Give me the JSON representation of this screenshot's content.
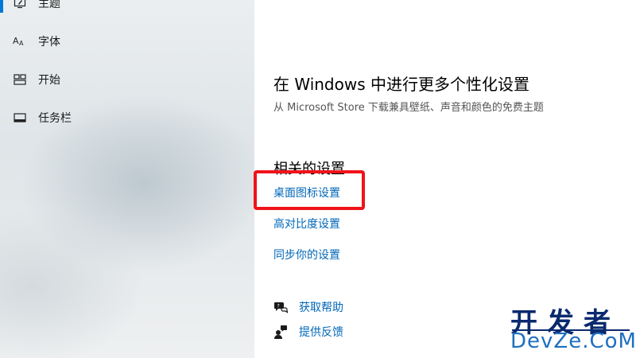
{
  "sidebar": {
    "items": [
      {
        "label": "主题",
        "icon": "theme-icon",
        "active": true
      },
      {
        "label": "字体",
        "icon": "font-icon"
      },
      {
        "label": "开始",
        "icon": "start-icon"
      },
      {
        "label": "任务栏",
        "icon": "taskbar-icon"
      }
    ]
  },
  "main": {
    "section_title": "在 Windows 中进行更多个性化设置",
    "section_subtitle": "从 Microsoft Store 下载兼具壁纸、声音和颜色的免费主题",
    "related_title": "相关的设置",
    "related_links": [
      "桌面图标设置",
      "高对比度设置",
      "同步你的设置"
    ],
    "help": {
      "get_help": "获取帮助",
      "feedback": "提供反馈"
    }
  },
  "watermark": {
    "top": "开发者",
    "bottom": "DevZe.CoM"
  },
  "colors": {
    "link": "#0067b8",
    "accent": "#0078d7",
    "highlight": "#f0131a"
  }
}
